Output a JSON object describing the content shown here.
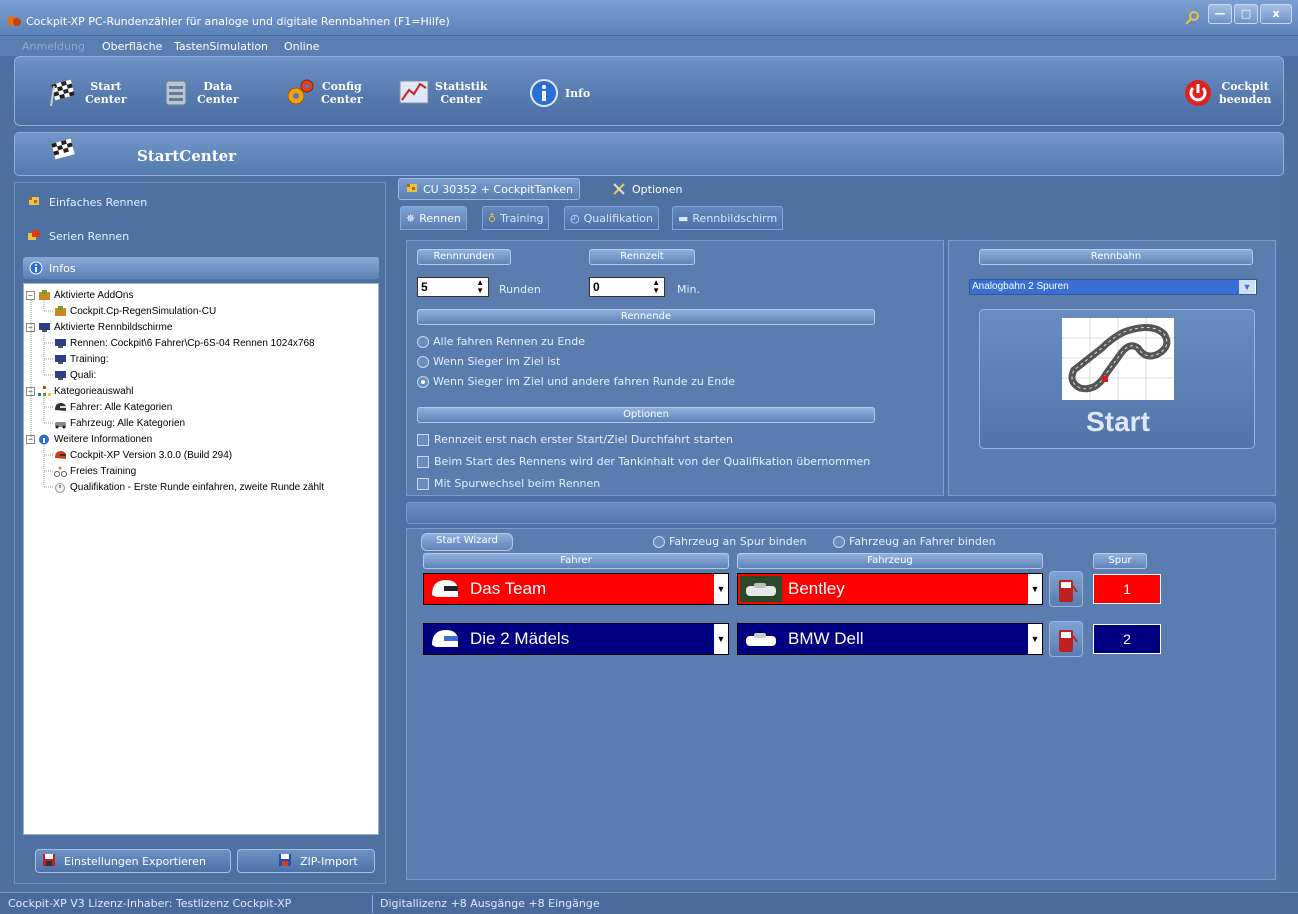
{
  "window": {
    "title": "Cockpit-XP PC-Rundenzähler für analoge und digitale Rennbahnen (F1=Hilfe)",
    "buttons": [
      "—",
      "□",
      "x"
    ]
  },
  "menu": [
    "Anmeldung",
    "Oberfläche",
    "TastenSimulation",
    "Online"
  ],
  "toolbar": {
    "start": "Start\nCenter",
    "data": "Data\nCenter",
    "config": "Config\nCenter",
    "statistik": "Statistik\nCenter",
    "info": "Info",
    "exit": "Cockpit\nbeenden"
  },
  "section": {
    "title": "StartCenter"
  },
  "left": {
    "simple_race": "Einfaches Rennen",
    "series_race": "Serien Rennen",
    "infos": "Infos",
    "tree": [
      {
        "level": 0,
        "exp": "−",
        "icon": "addon-icon",
        "text": "Aktivierte AddOns"
      },
      {
        "level": 1,
        "icon": "addon-icon",
        "text": "Cockpit.Cp-RegenSimulation-CU"
      },
      {
        "level": 0,
        "exp": "−",
        "icon": "monitor-icon",
        "text": "Aktivierte Rennbildschirme"
      },
      {
        "level": 1,
        "icon": "monitor-icon",
        "text": "Rennen: Cockpit\\6 Fahrer\\Cp-6S-04 Rennen 1024x768"
      },
      {
        "level": 1,
        "icon": "monitor-icon",
        "text": "Training:"
      },
      {
        "level": 1,
        "icon": "monitor-icon",
        "text": "Quali:"
      },
      {
        "level": 0,
        "exp": "−",
        "icon": "category-icon",
        "text": "Kategorieauswahl"
      },
      {
        "level": 1,
        "icon": "helmet-icon",
        "text": "Fahrer: Alle Kategorien"
      },
      {
        "level": 1,
        "icon": "car-icon",
        "text": "Fahrzeug: Alle Kategorien"
      },
      {
        "level": 0,
        "exp": "−",
        "icon": "info-icon",
        "text": "Weitere Informationen"
      },
      {
        "level": 1,
        "icon": "helmet-icon",
        "text": "Cockpit-XP Version 3.0.0 (Build 294)"
      },
      {
        "level": 1,
        "icon": "bike-icon",
        "text": "Freies Training"
      },
      {
        "level": 1,
        "icon": "stopwatch-icon",
        "text": "Qualifikation - Erste Runde einfahren, zweite Runde zählt"
      }
    ],
    "export_button": "Einstellungen Exportieren",
    "zip_button": "ZIP-Import"
  },
  "right": {
    "top_tabs": [
      "CU 30352 + CockpitTanken",
      "Optionen"
    ],
    "sub_tabs": [
      "Rennen",
      "Training",
      "Qualifikation",
      "Rennbildschirm"
    ],
    "rennrunden_label": "Rennrunden",
    "rennzeit_label": "Rennzeit",
    "laps_value": "5",
    "laps_unit": "Runden",
    "time_value": "0",
    "time_unit": "Min.",
    "rennende_label": "Rennende",
    "race_end_options": [
      "Alle fahren Rennen zu Ende",
      "Wenn Sieger im Ziel ist",
      "Wenn Sieger im Ziel und andere fahren Runde zu Ende"
    ],
    "race_end_selected_index": 2,
    "optionen_label": "Optionen",
    "checkboxes": [
      "Rennzeit erst nach erster Start/Ziel Durchfahrt starten",
      "Beim Start des Rennens wird der Tankinhalt von der Qualifikation übernommen",
      "Mit Spurwechsel beim Rennen"
    ],
    "rennbahn_label": "Rennbahn",
    "track_value": "Analogbahn 2 Spuren",
    "start_label": "Start",
    "start_wizard": "Start Wizard",
    "bind_lane": "Fahrzeug an Spur binden",
    "bind_driver": "Fahrzeug an Fahrer binden",
    "col_driver": "Fahrer",
    "col_car": "Fahrzeug",
    "col_lane": "Spur",
    "rows": [
      {
        "driver": "Das Team",
        "car": "Bentley",
        "lane": "1",
        "color": "#ff0000"
      },
      {
        "driver": "Die 2 Mädels",
        "car": "BMW Dell",
        "lane": "2",
        "color": "#000080"
      }
    ]
  },
  "status": {
    "license": "Cockpit-XP V3 Lizenz-Inhaber: Testlizenz Cockpit-XP",
    "digital": "Digitallizenz +8 Ausgänge +8 Eingänge"
  }
}
